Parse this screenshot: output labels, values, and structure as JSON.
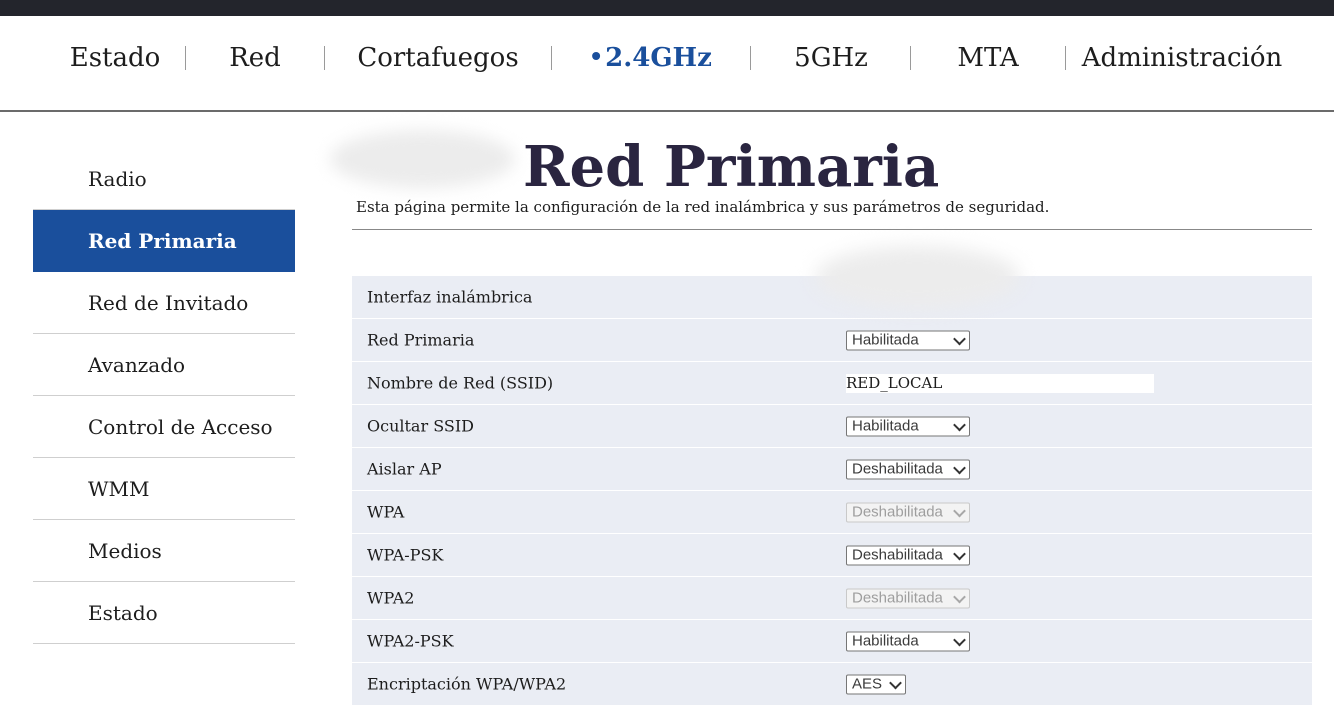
{
  "nav": {
    "items": [
      {
        "label": "Estado",
        "active": false
      },
      {
        "label": "Red",
        "active": false
      },
      {
        "label": "Cortafuegos",
        "active": false
      },
      {
        "label": "2.4GHz",
        "active": true
      },
      {
        "label": "5GHz",
        "active": false
      },
      {
        "label": "MTA",
        "active": false
      },
      {
        "label": "Administración",
        "active": false
      }
    ]
  },
  "sidebar": {
    "items": [
      {
        "label": "Radio",
        "active": false
      },
      {
        "label": "Red Primaria",
        "active": true
      },
      {
        "label": "Red de Invitado",
        "active": false
      },
      {
        "label": "Avanzado",
        "active": false
      },
      {
        "label": "Control de Acceso",
        "active": false
      },
      {
        "label": "WMM",
        "active": false
      },
      {
        "label": "Medios",
        "active": false
      },
      {
        "label": "Estado",
        "active": false
      }
    ]
  },
  "page": {
    "title": "Red Primaria",
    "description": "Esta página permite la configuración de la red inalámbrica y sus parámetros de seguridad."
  },
  "form": {
    "interface_label": "Interfaz inalámbrica",
    "primary_label": "Red Primaria",
    "primary_value": "Habilitada",
    "ssid_label": "Nombre de Red (SSID)",
    "ssid_value": "RED_LOCAL",
    "hide_ssid_label": "Ocultar SSID",
    "hide_ssid_value": "Habilitada",
    "isolate_ap_label": "Aislar AP",
    "isolate_ap_value": "Deshabilitada",
    "wpa_label": "WPA",
    "wpa_value": "Deshabilitada",
    "wpa_psk_label": "WPA-PSK",
    "wpa_psk_value": "Deshabilitada",
    "wpa2_label": "WPA2",
    "wpa2_value": "Deshabilitada",
    "wpa2_psk_label": "WPA2-PSK",
    "wpa2_psk_value": "Habilitada",
    "encryption_label": "Encriptación WPA/WPA2",
    "encryption_value": "AES"
  },
  "colors": {
    "accent": "#1a4f9c",
    "title": "#2a2540",
    "form_background": "#eaedf4",
    "top_strip": "#23252c"
  }
}
